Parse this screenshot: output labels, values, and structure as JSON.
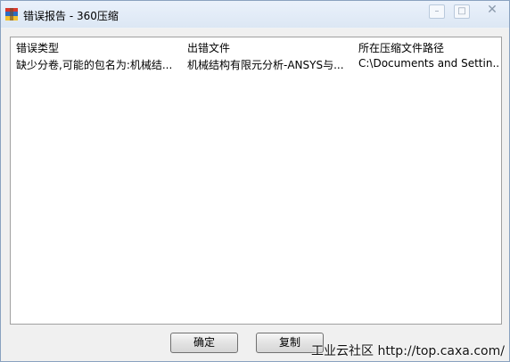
{
  "window": {
    "title": "错误报告 - 360压缩",
    "controls": {
      "minimize": "–",
      "maximize": "□",
      "close": "✕"
    }
  },
  "list": {
    "columns": [
      "错误类型",
      "出错文件",
      "所在压缩文件路径"
    ],
    "rows": [
      [
        "缺少分卷,可能的包名为:机械结...",
        "机械结构有限元分析-ANSYS与...",
        "C:\\Documents and Settin..."
      ]
    ]
  },
  "buttons": {
    "ok": "确定",
    "copy": "复制"
  },
  "watermark": "工业云社区 http://top.caxa.com/",
  "colors": {
    "title_bar": "#dce7f4",
    "list_border": "#a0a0a0",
    "icon_red": "#d9382c",
    "icon_blue": "#2d6cc0",
    "icon_yellow": "#f2c12e"
  }
}
